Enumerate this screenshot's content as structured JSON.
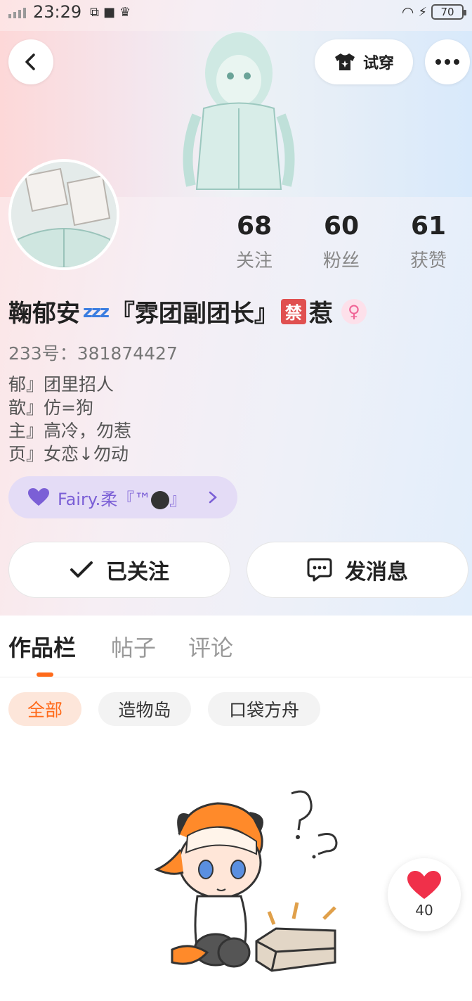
{
  "status_bar": {
    "time": "23:29",
    "battery": "70",
    "icons": [
      "signal-icon",
      "sync-icon",
      "video-icon",
      "crown-icon",
      "wifi-icon",
      "charging-icon"
    ]
  },
  "header": {
    "try_on_label": "试穿",
    "icons": {
      "back": "chevron-left-icon",
      "try_on": "tshirt-icon",
      "more": "more-dots-icon"
    }
  },
  "stats": [
    {
      "value": "68",
      "label": "关注"
    },
    {
      "value": "60",
      "label": "粉丝"
    },
    {
      "value": "61",
      "label": "获赞"
    }
  ],
  "profile": {
    "name_part1": "鞠郁安",
    "name_zzz": "zzz",
    "name_part2": "『雰团副团长』",
    "ban_char": "禁",
    "name_part3": "惹",
    "gender_symbol": "♀",
    "uid": "233号：381874427",
    "bio": [
      "郁』团里招人",
      "歆』仿=狗",
      "主』高冷，勿惹",
      "页』女恋↓勿动"
    ]
  },
  "fan_badge": {
    "prefix": "Fairy.柔『™",
    "suffix": "』"
  },
  "actions": {
    "follow_label": "已关注",
    "message_label": "发消息"
  },
  "tabs": [
    "作品栏",
    "帖子",
    "评论"
  ],
  "filters": [
    "全部",
    "造物岛",
    "口袋方舟"
  ],
  "like_button": {
    "count": "40"
  },
  "colors": {
    "accent": "#ff6a1a",
    "badge_purple": "#7b5fd6",
    "heart": "#f0304a"
  }
}
